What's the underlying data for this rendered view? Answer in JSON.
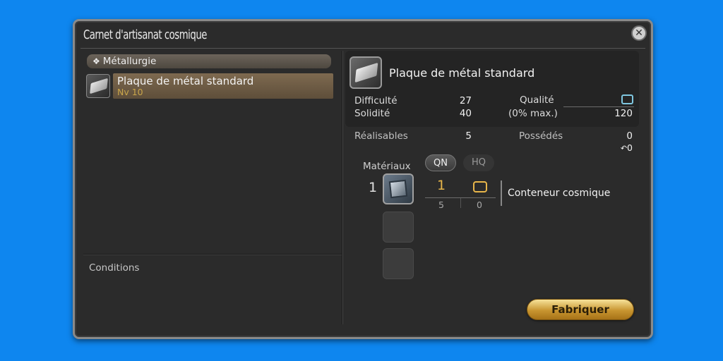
{
  "window": {
    "title": "Carnet d'artisanat cosmique",
    "close_icon": "close-icon"
  },
  "left": {
    "category": "Métallurgie",
    "category_icon": "diamond-icon",
    "recipe": {
      "name": "Plaque de métal standard",
      "level": "Nv 10",
      "icon": "metal-plate-icon"
    },
    "conditions_label": "Conditions"
  },
  "detail": {
    "item_name": "Plaque de métal standard",
    "item_icon": "metal-plate-icon",
    "difficulty_label": "Difficulté",
    "difficulty": "27",
    "durability_label": "Solidité",
    "durability": "40",
    "quality_label": "Qualité",
    "quality_max_label": "(0% max.)",
    "quality_max": "120",
    "craftable_label": "Réalisables",
    "craftable": "5",
    "owned_label": "Possédés",
    "owned": "0",
    "owned_hq": "0"
  },
  "materials": {
    "label": "Matériaux",
    "nq_button": "QN",
    "hq_button": "HQ",
    "items": [
      {
        "qty": "1",
        "name": "Conteneur cosmique",
        "icon": "cosmic-container-icon",
        "nq_count": "1",
        "nq_have": "5",
        "hq_have": "0"
      }
    ]
  },
  "actions": {
    "craft_label": "Fabriquer"
  },
  "colors": {
    "background": "#0e86ef",
    "panel": "#2b2b2b",
    "accent_gold": "#e8b64a",
    "quality_blue": "#7fc7e0"
  }
}
